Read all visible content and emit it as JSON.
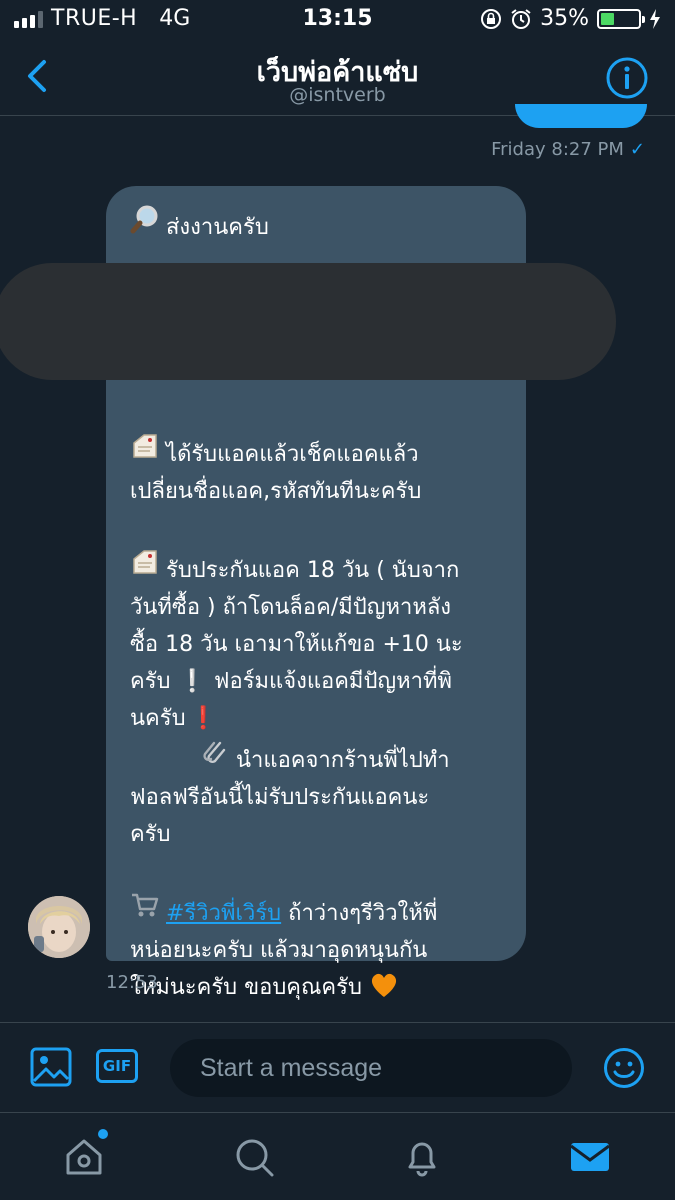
{
  "status_bar": {
    "carrier": "TRUE-H",
    "network": "4G",
    "time": "13:15",
    "battery_percent": "35%",
    "battery_level": 0.35
  },
  "header": {
    "title": "เว็บพ่อค้าแซ่บ",
    "handle": "@isntverb"
  },
  "previous_message": {
    "timestamp": "Friday 8:27 PM"
  },
  "message": {
    "lines": {
      "l1": "ส่งงานครับ",
      "l2": "ได้รับแอคแล้วเช็คแอคแล้ว",
      "l3": "เปลี่ยนชื่อแอค,รหัสทันทีนะครับ",
      "l4": "รับประกันแอค 18 วัน ( นับจาก",
      "l5": "วันที่ซื้อ ) ถ้าโดนล็อค/มีปัญหาหลัง",
      "l6": "ซื้อ 18 วัน เอามาให้แก้ขอ +10 นะ",
      "l7a": "ครับ",
      "l7b": "ฟอร์มแจ้งแอคมีปัญหาที่พิ",
      "l8": "นครับ",
      "l9": "นำแอคจากร้านพี่ไปทำ",
      "l10": "ฟอลฟรีอันนี้ไม่รับประกันแอคนะ",
      "l11": "ครับ",
      "l12_link": "#รีวิวพี่เวิร์บ",
      "l12_rest": " ถ้าว่างๆรีวิวให้พี่",
      "l13": "หน่อยนะครับ แล้วมาอุดหนุนกัน",
      "l14": "ใหม่นะครับ ขอบคุณครับ"
    },
    "time": "12:53"
  },
  "composer": {
    "placeholder": "Start a message",
    "gif_label": "GIF"
  },
  "colors": {
    "background": "#15202b",
    "accent": "#1da1f2",
    "bubble": "#3d5466"
  },
  "icons": {
    "back": "chevron-left-icon",
    "info": "info-icon",
    "media": "image-icon",
    "emoji": "smiley-icon",
    "home": "home-icon",
    "search": "search-icon",
    "notifications": "bell-icon",
    "messages": "mail-icon"
  }
}
